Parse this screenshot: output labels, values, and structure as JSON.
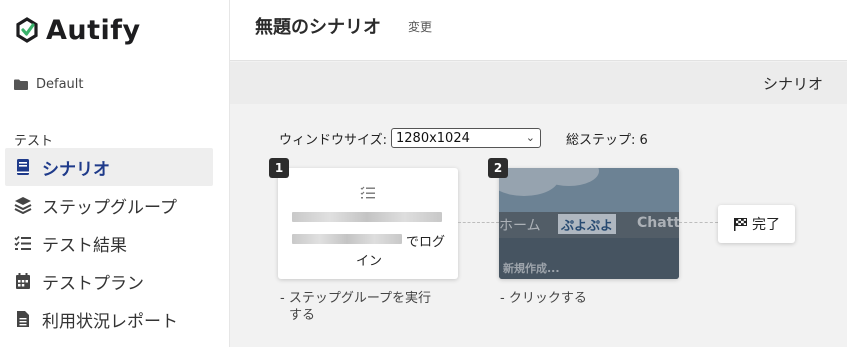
{
  "app": {
    "brand": "Autify",
    "brand_color": "#1e3a8a",
    "accent_green": "#3ab26b"
  },
  "sidebar": {
    "project": {
      "icon": "folder-icon",
      "label": "Default"
    },
    "section_label": "テスト",
    "items": [
      {
        "label": "シナリオ",
        "icon": "book-icon",
        "active": true
      },
      {
        "label": "ステップグループ",
        "icon": "layers-icon",
        "active": false
      },
      {
        "label": "テスト結果",
        "icon": "checklist-icon",
        "active": false
      },
      {
        "label": "テストプラン",
        "icon": "calendar-icon",
        "active": false
      },
      {
        "label": "利用状況レポート",
        "icon": "document-icon",
        "active": false
      }
    ]
  },
  "header": {
    "title": "無題のシナリオ",
    "edit_label": "変更"
  },
  "subbar": {
    "tab_label": "シナリオ"
  },
  "controls": {
    "window_size_label": "ウィンドウサイズ:",
    "window_size_value": "1280x1024",
    "total_steps_label": "総ステップ: 6"
  },
  "steps": [
    {
      "number": "1",
      "text_suffix": "でログ",
      "text_line2": "イン",
      "description": "- ステップグループを実行",
      "description_line2": "する"
    },
    {
      "number": "2",
      "screenshot": {
        "nav_left": "ホーム",
        "nav_active": "ぷよぷよ",
        "nav_right": "Chatt",
        "band_text": "新規作成..."
      },
      "description": "- クリックする"
    }
  ],
  "finish": {
    "label": "完了",
    "icon": "checkered-flag-icon"
  }
}
